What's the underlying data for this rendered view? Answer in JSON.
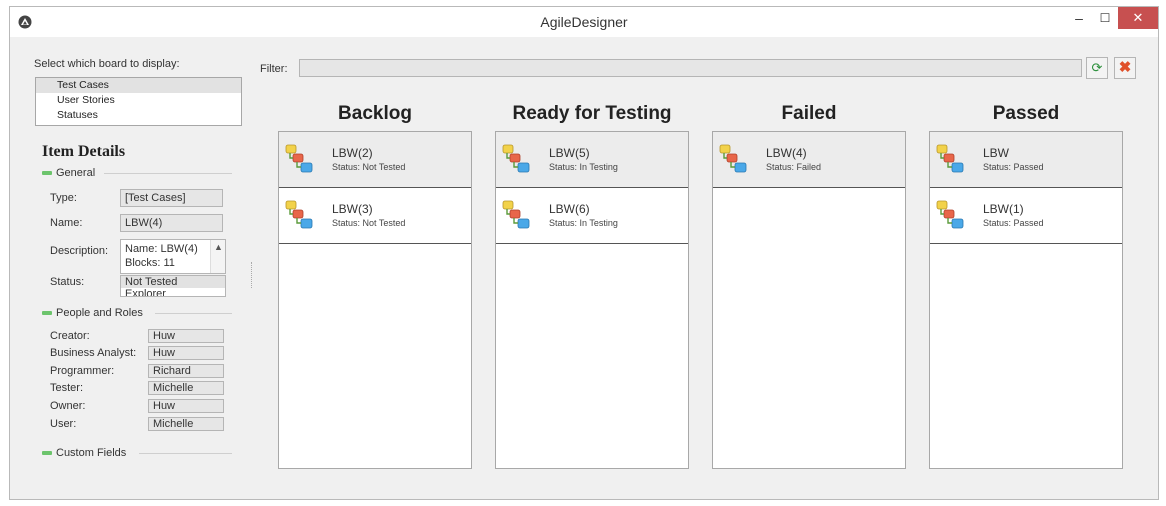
{
  "window": {
    "title": "AgileDesigner"
  },
  "board_selector": {
    "label": "Select which board to display:",
    "options": [
      "Test Cases",
      "User Stories",
      "Statuses"
    ],
    "selected": "Test Cases"
  },
  "filter": {
    "label": "Filter:",
    "value": ""
  },
  "item_details": {
    "title": "Item Details",
    "general": {
      "header": "General",
      "type_label": "Type:",
      "type_value": "[Test Cases]",
      "name_label": "Name:",
      "name_value": "LBW(4)",
      "description_label": "Description:",
      "description_line1": "Name: LBW(4)",
      "description_line2": "Blocks: 11",
      "status_label": "Status:",
      "status_selected": "Not Tested",
      "status_next": "Explorer"
    },
    "people": {
      "header": "People and Roles",
      "rows": [
        {
          "label": "Creator:",
          "value": "Huw"
        },
        {
          "label": "Business Analyst:",
          "value": "Huw"
        },
        {
          "label": "Programmer:",
          "value": "Richard"
        },
        {
          "label": "Tester:",
          "value": "Michelle"
        },
        {
          "label": "Owner:",
          "value": "Huw"
        },
        {
          "label": "User:",
          "value": "Michelle"
        }
      ]
    },
    "custom_fields": {
      "header": "Custom Fields"
    }
  },
  "board": {
    "columns": [
      {
        "title": "Backlog",
        "cards": [
          {
            "name": "LBW(2)",
            "status": "Status: Not Tested"
          },
          {
            "name": "LBW(3)",
            "status": "Status: Not Tested"
          }
        ]
      },
      {
        "title": "Ready for Testing",
        "cards": [
          {
            "name": "LBW(5)",
            "status": "Status: In Testing"
          },
          {
            "name": "LBW(6)",
            "status": "Status: In Testing"
          }
        ]
      },
      {
        "title": "Failed",
        "cards": [
          {
            "name": "LBW(4)",
            "status": "Status: Failed"
          }
        ]
      },
      {
        "title": "Passed",
        "cards": [
          {
            "name": "LBW",
            "status": "Status: Passed"
          },
          {
            "name": "LBW(1)",
            "status": "Status: Passed"
          }
        ]
      }
    ]
  },
  "colors": {
    "close_button": "#c75050",
    "section_dash": "#6cc46c",
    "selected_bg": "#ececec"
  },
  "icons": [
    "app-logo-icon",
    "minimize-icon",
    "maximize-icon",
    "close-icon",
    "refresh-icon",
    "clear-filter-icon",
    "test-case-icon",
    "scroll-up-icon"
  ]
}
